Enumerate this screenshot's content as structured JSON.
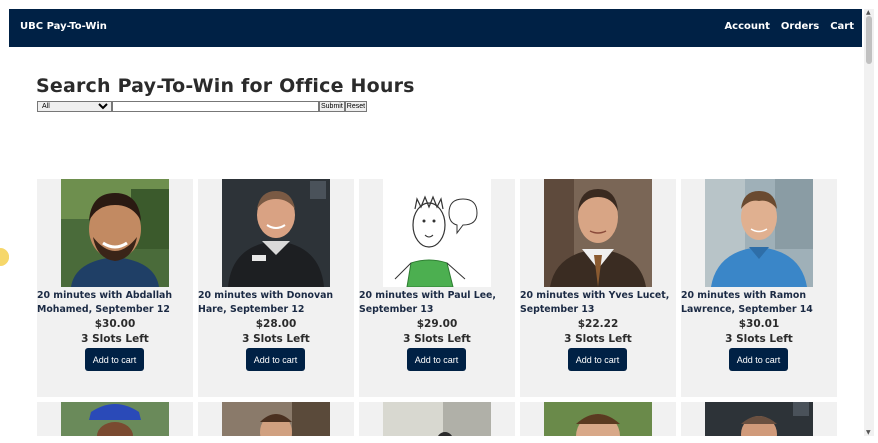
{
  "header": {
    "brand": "UBC Pay-To-Win",
    "nav": [
      "Account",
      "Orders",
      "Cart"
    ]
  },
  "page_title": "Search Pay-To-Win for Office Hours",
  "search": {
    "category_selected": "All",
    "query_value": "",
    "submit_label": "Submit",
    "reset_label": "Reset"
  },
  "products": [
    {
      "title": "20 minutes with Abdallah Mohamed, September 12",
      "price": "$30.00",
      "slots": "3 Slots Left",
      "button": "Add to cart"
    },
    {
      "title": "20 minutes with Donovan Hare, September 12",
      "price": "$28.00",
      "slots": "3 Slots Left",
      "button": "Add to cart"
    },
    {
      "title": "20 minutes with Paul Lee, September 13",
      "price": "$29.00",
      "slots": "3 Slots Left",
      "button": "Add to cart"
    },
    {
      "title": "20 minutes with Yves Lucet, September 13",
      "price": "$22.22",
      "slots": "3 Slots Left",
      "button": "Add to cart"
    },
    {
      "title": "20 minutes with Ramon Lawrence, September 14",
      "price": "$30.01",
      "slots": "3 Slots Left",
      "button": "Add to cart"
    }
  ],
  "colors": {
    "navy": "#002145",
    "card_bg": "#f1f1f1"
  }
}
